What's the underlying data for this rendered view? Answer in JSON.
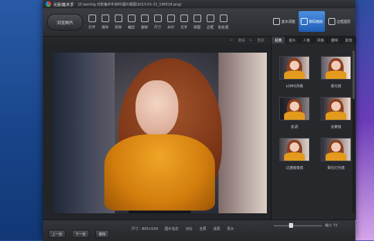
{
  "app": {
    "name": "光影魔术手",
    "file_path": "[E:\\work\\g-光影魔术手资料\\图片截图\\2013-01-31_190518.png]"
  },
  "toolbar": {
    "browse_label": "浏览图片",
    "tools": [
      {
        "icon": "folder-open-icon",
        "label": "打开"
      },
      {
        "icon": "save-icon",
        "label": "保存"
      },
      {
        "icon": "save-as-icon",
        "label": "另存"
      },
      {
        "icon": "crop-icon",
        "label": "裁剪"
      },
      {
        "icon": "rotate-icon",
        "label": "旋转"
      },
      {
        "icon": "resize-icon",
        "label": "尺寸"
      },
      {
        "icon": "watermark-icon",
        "label": "水印"
      },
      {
        "icon": "text-icon",
        "label": "文字"
      },
      {
        "icon": "collage-icon",
        "label": "拼图"
      },
      {
        "icon": "border-icon",
        "label": "边框"
      },
      {
        "icon": "batch-icon",
        "label": "批处理"
      }
    ],
    "modes": [
      {
        "icon": "adjust-icon",
        "label": "基本调整",
        "active": false
      },
      {
        "icon": "camera-icon",
        "label": "数码暗房",
        "active": true
      },
      {
        "icon": "border-mode-icon",
        "label": "边框图层",
        "active": false
      }
    ]
  },
  "subbar": {
    "undo_label": "撤销",
    "redo_label": "重做"
  },
  "side_panel": {
    "tabs": [
      "经典",
      "胶片",
      "人像",
      "风格",
      "趣味",
      "其他"
    ],
    "active_tab": 0,
    "effects": [
      "LOMO风格",
      "柔光镜",
      "影调",
      "去雾镜",
      "过渡暗角镜",
      "晕化灯光镜"
    ]
  },
  "status": {
    "prev_label": "上一张",
    "next_label": "下一张",
    "delete_label": "删除",
    "size_text": "尺寸：800×534",
    "info_label": "图片信息",
    "compare_label": "对比",
    "fullscreen_label": "全屏",
    "fit_label": "适屏",
    "original_label": "原大",
    "zoom_text": "缩小 73"
  }
}
